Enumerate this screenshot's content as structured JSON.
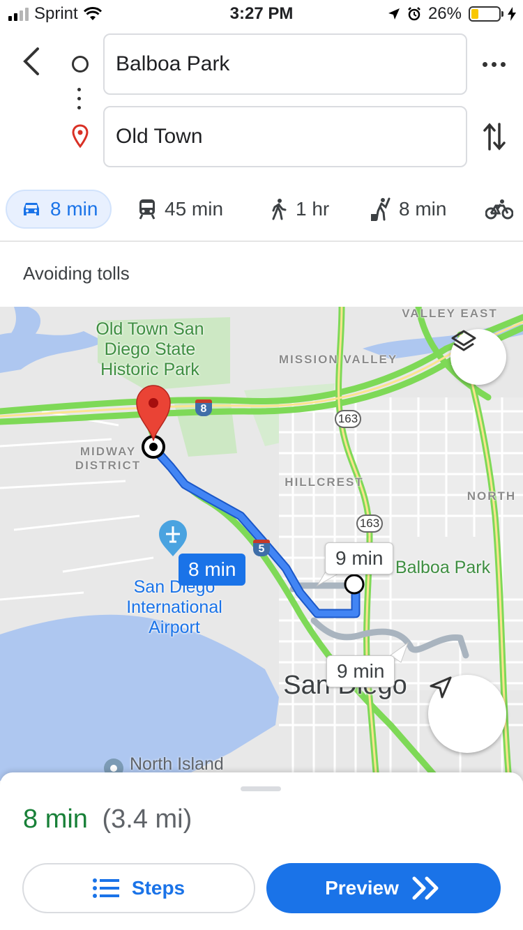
{
  "status": {
    "carrier": "Sprint",
    "time": "3:27 PM",
    "battery": "26%",
    "battery_level": 0.26
  },
  "directions": {
    "origin": "Balboa Park",
    "destination": "Old Town"
  },
  "modes": [
    {
      "icon": "car-icon",
      "label": "8 min",
      "selected": true
    },
    {
      "icon": "transit-icon",
      "label": "45 min"
    },
    {
      "icon": "walk-icon",
      "label": "1 hr"
    },
    {
      "icon": "rideshare-icon",
      "label": "8 min"
    },
    {
      "icon": "bike-icon",
      "label": ""
    }
  ],
  "route_option": "Avoiding tolls",
  "map": {
    "labels": {
      "old_town_park": "Old Town San Diego State Historic Park",
      "mission_valley": "MISSION VALLEY",
      "valley_east": "VALLEY EAST",
      "midway": "MIDWAY DISTRICT",
      "hillcrest": "HILLCREST",
      "north": "NORTH",
      "balboa_park": "Balboa Park",
      "airport": "San Diego International Airport",
      "san_diego": "San Diego",
      "north_island": "North Island"
    },
    "highways": {
      "i8": "8",
      "sr163_a": "163",
      "sr163_b": "163",
      "i5": "5"
    },
    "bubbles": {
      "primary": "8 min",
      "alt1": "9 min",
      "alt2": "9 min"
    },
    "colors": {
      "route": "#4285f4",
      "alt_route": "#a9b4bf",
      "traffic": "#7ed957"
    }
  },
  "summary": {
    "duration": "8 min",
    "distance": "(3.4 mi)"
  },
  "buttons": {
    "steps": "Steps",
    "preview": "Preview"
  }
}
